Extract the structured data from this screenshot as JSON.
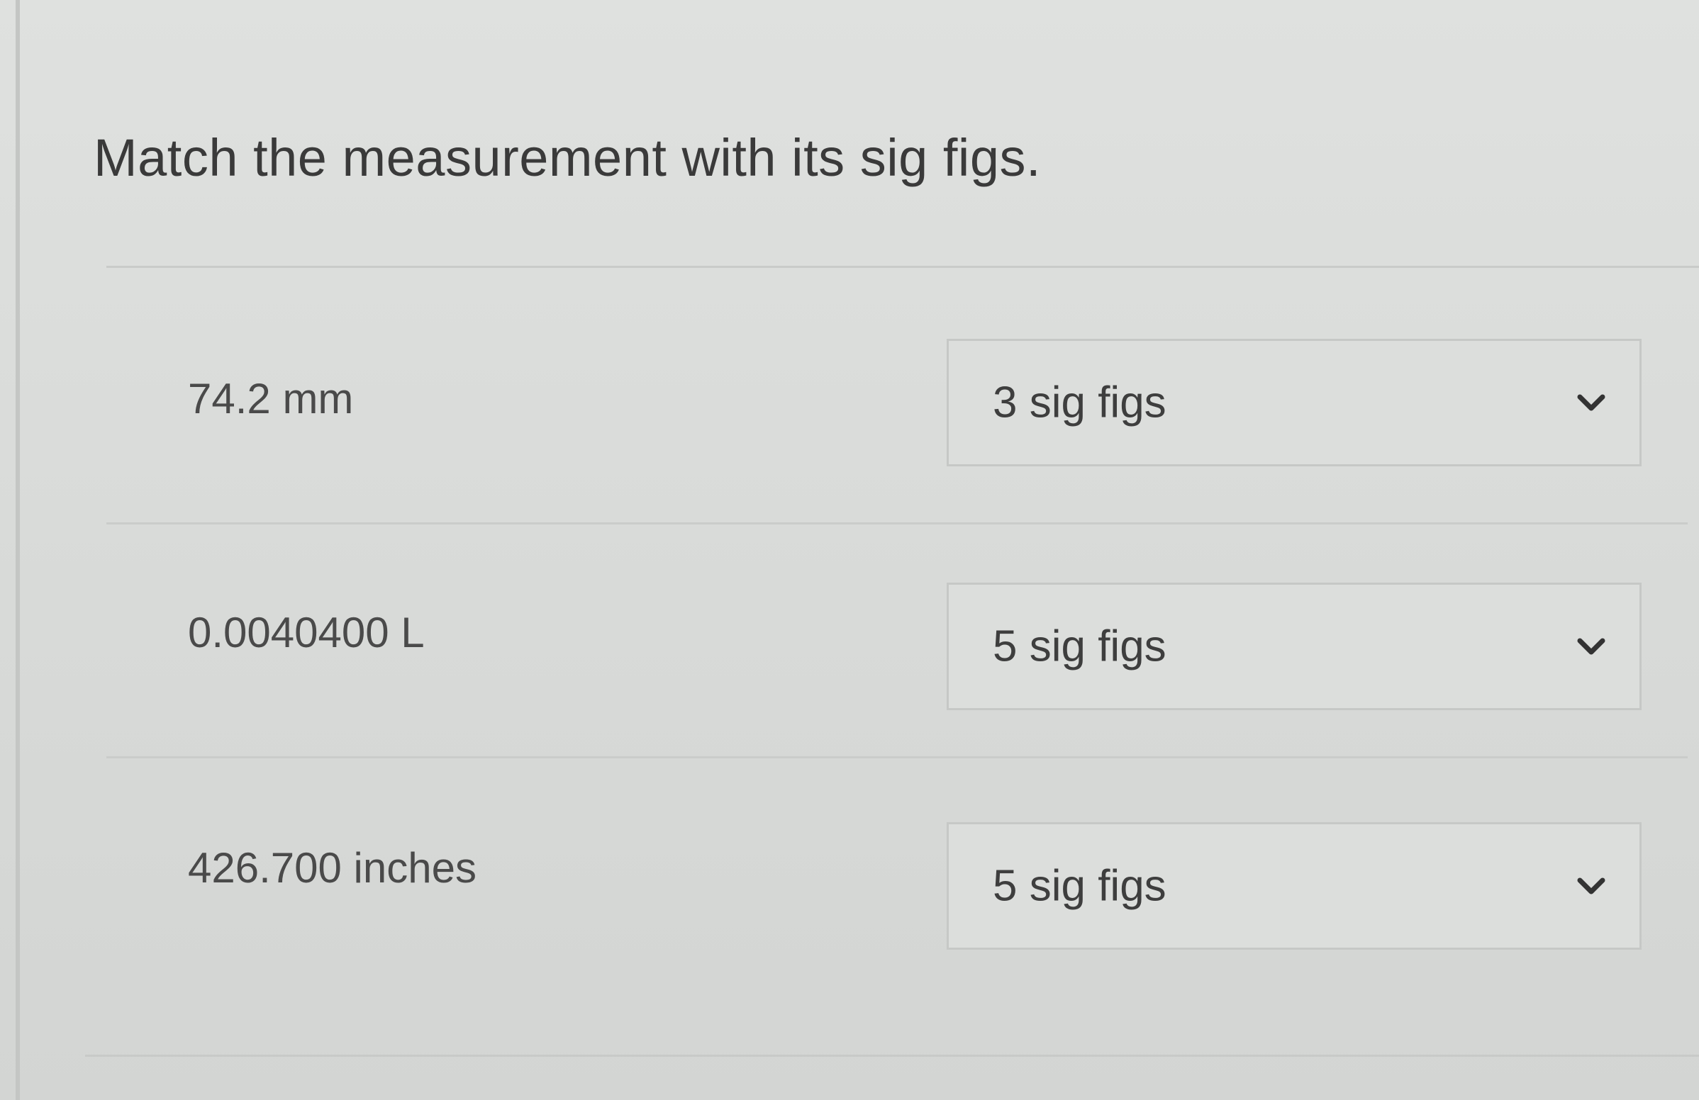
{
  "question": {
    "title": "Match the measurement with its sig figs."
  },
  "rows": [
    {
      "measurement": "74.2 mm",
      "selected": "3 sig figs"
    },
    {
      "measurement": "0.0040400 L",
      "selected": "5 sig figs"
    },
    {
      "measurement": "426.700 inches",
      "selected": "5 sig figs"
    }
  ],
  "icons": {
    "dropdown": "chevron-down-icon"
  },
  "colors": {
    "background": "#d9dbd9",
    "text": "#3e3e3e",
    "border": "#c6c8c6"
  }
}
